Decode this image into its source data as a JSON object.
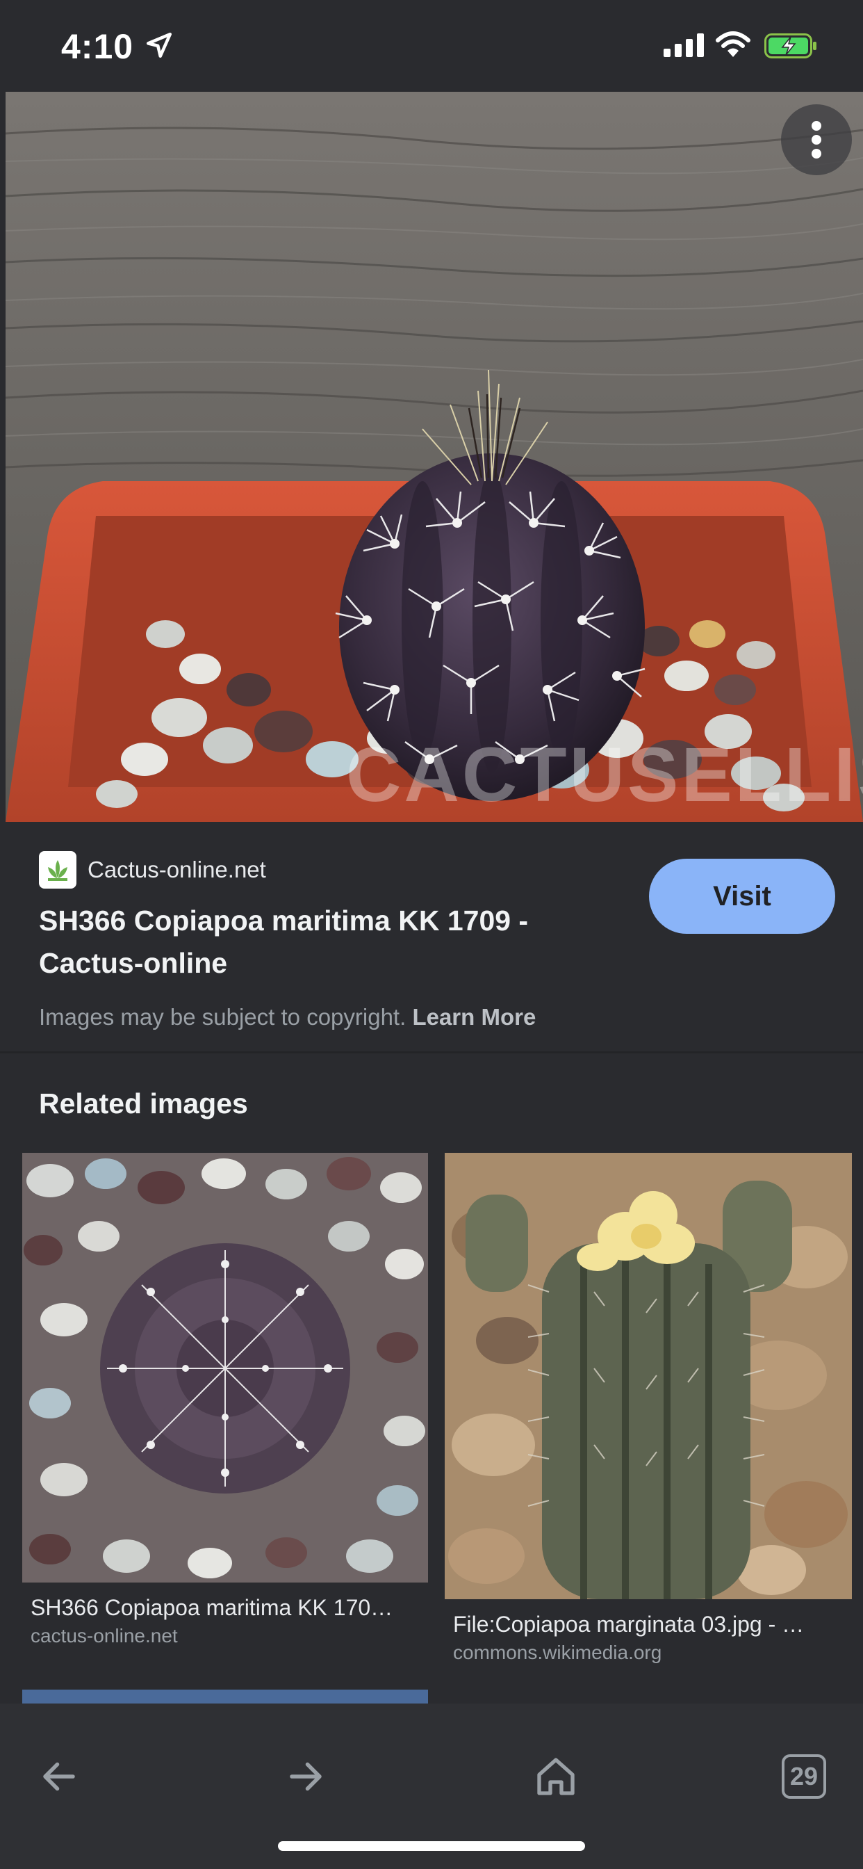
{
  "status_bar": {
    "time": "4:10"
  },
  "result": {
    "site_name": "Cactus-online.net",
    "title": "SH366 Copiapoa maritima KK 1709 - Cactus-online",
    "visit_label": "Visit",
    "copyright_text": "Images may be subject to copyright.",
    "learn_more": "Learn More",
    "watermark": "CACTUSELLIS"
  },
  "related": {
    "heading": "Related images",
    "items": [
      {
        "title": "SH366 Copiapoa maritima KK 170…",
        "domain": "cactus-online.net"
      },
      {
        "title": "File:Copiapoa marginata 03.jpg - …",
        "domain": "commons.wikimedia.org"
      }
    ]
  },
  "toolbar": {
    "tab_count": "29"
  },
  "colors": {
    "background": "#2a2b2f",
    "accent": "#8ab4f8",
    "pot": "#c24a2c"
  }
}
